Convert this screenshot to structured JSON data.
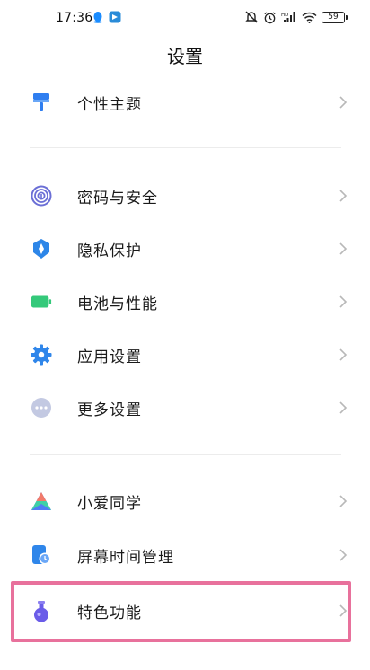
{
  "status_bar": {
    "time": "17:36",
    "battery": "59"
  },
  "page_title": "设置",
  "items": [
    {
      "label": "个性主题",
      "icon": "paint-brush-icon",
      "color": "#2f7ef0"
    },
    {
      "label": "密码与安全",
      "icon": "fingerprint-icon",
      "color": "#6b6fd6"
    },
    {
      "label": "隐私保护",
      "icon": "privacy-shield-icon",
      "color": "#2d86e8"
    },
    {
      "label": "电池与性能",
      "icon": "battery-icon",
      "color": "#34c97a"
    },
    {
      "label": "应用设置",
      "icon": "gear-icon",
      "color": "#2f86ea"
    },
    {
      "label": "更多设置",
      "icon": "more-dots-icon",
      "color": "#8a93b8"
    },
    {
      "label": "小爱同学",
      "icon": "xiaoai-icon",
      "color": "#4f7cf5"
    },
    {
      "label": "屏幕时间管理",
      "icon": "screen-time-icon",
      "color": "#2f86ea"
    },
    {
      "label": "特色功能",
      "icon": "flask-icon",
      "color": "#6a5ce8"
    }
  ],
  "colors": {
    "highlight": "#e8719c",
    "chevron": "#b8b8b8"
  }
}
